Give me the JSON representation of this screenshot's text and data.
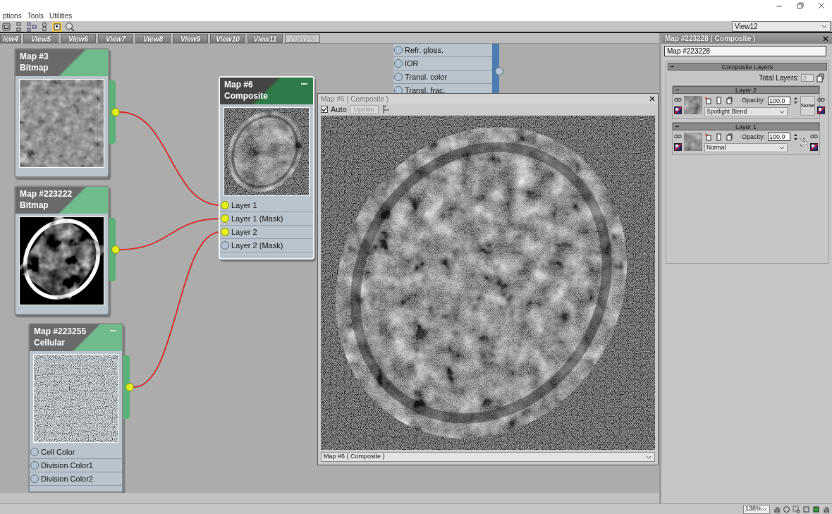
{
  "menu": [
    "ptions",
    "Tools",
    "Utilities"
  ],
  "view_dropdown": "View12",
  "tabs": [
    {
      "label": "iew4",
      "selected": false
    },
    {
      "label": "View5",
      "selected": false
    },
    {
      "label": "View6",
      "selected": false
    },
    {
      "label": "View7",
      "selected": false
    },
    {
      "label": "View8",
      "selected": false
    },
    {
      "label": "View9",
      "selected": false
    },
    {
      "label": "View10",
      "selected": false
    },
    {
      "label": "View11",
      "selected": false
    },
    {
      "label": "View12",
      "selected": true
    }
  ],
  "nodes": [
    {
      "kind": "map",
      "title": "Map #3",
      "type": "Bitmap",
      "selected": false,
      "minimize": false,
      "output_connected": true
    },
    {
      "kind": "map",
      "title": "Map #223222",
      "type": "Bitmap",
      "selected": false,
      "minimize": false,
      "output_connected": true
    },
    {
      "kind": "map",
      "title": "Map #223255",
      "type": "Cellular",
      "selected": false,
      "minimize": true,
      "output_connected": true,
      "inputs": [
        {
          "label": "Cell Color",
          "connected": false
        },
        {
          "label": "Division Color1",
          "connected": false
        },
        {
          "label": "Division Color2",
          "connected": false
        }
      ]
    },
    {
      "kind": "map",
      "title": "Map #6",
      "type": "Composite",
      "selected": true,
      "minimize": true,
      "inputs": [
        {
          "label": "Layer 1",
          "connected": true
        },
        {
          "label": "Layer 1 (Mask)",
          "connected": true
        },
        {
          "label": "Layer 2",
          "connected": true
        },
        {
          "label": "Layer 2 (Mask)",
          "connected": false
        }
      ]
    },
    {
      "kind": "partial",
      "output_connected": false,
      "inputs": [
        {
          "label": "Refr. gloss.",
          "connected": false
        },
        {
          "label": "IOR",
          "connected": false
        },
        {
          "label": "Transl. color",
          "connected": false
        },
        {
          "label": "Transl. frac.",
          "connected": false
        }
      ]
    }
  ],
  "preview": {
    "title": "Map #6  ( Composite )",
    "auto": {
      "label": "Auto",
      "checked": true
    },
    "update": {
      "label": "Update",
      "disabled": true
    },
    "footer": "Map #6  ( Composite )"
  },
  "panel": {
    "title": "Map #223228  ( Composite )",
    "name": "Map #223228",
    "rollout": "Composite Layers",
    "total_layers_label": "Total Layers:",
    "total_layers": "2",
    "layers": [
      {
        "title": "Layer 2",
        "opacity_label": "Opacity:",
        "opacity": "100,0",
        "blend": "Spotlight Blend",
        "mask": {
          "kind": "text",
          "label": "None"
        }
      },
      {
        "title": "Layer 1",
        "opacity_label": "Opacity:",
        "opacity": "100,0",
        "blend": "Normal",
        "mask": {
          "kind": "texture"
        }
      }
    ]
  },
  "status": {
    "zoom": "138%"
  }
}
